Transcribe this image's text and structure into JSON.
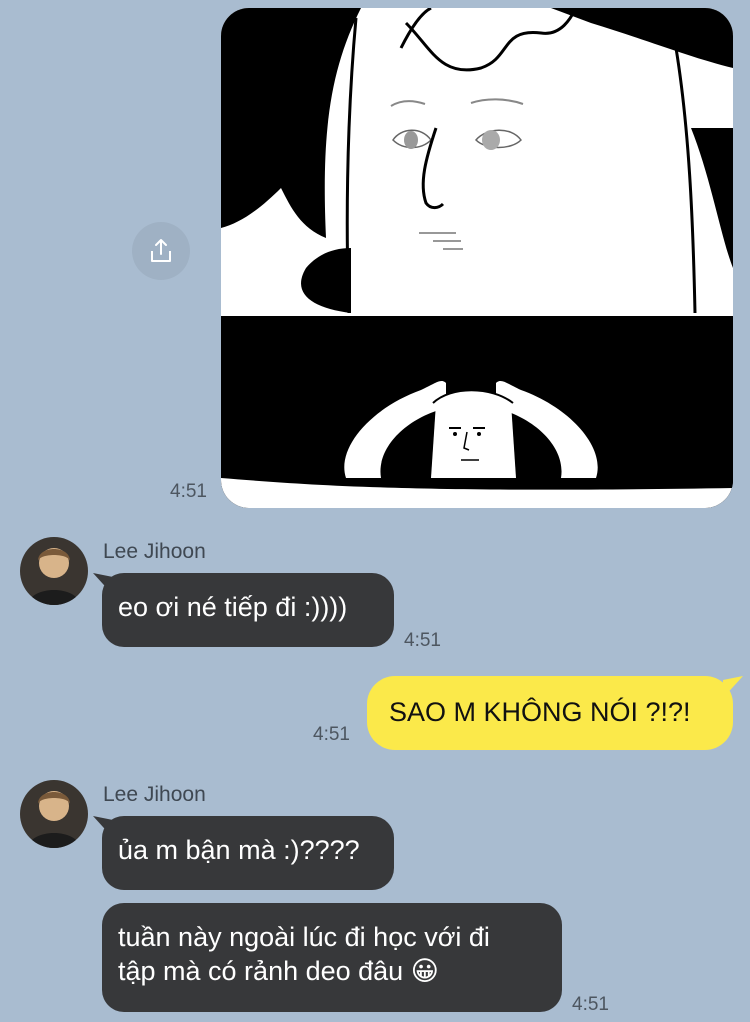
{
  "messages": {
    "image": {
      "time": "4:51",
      "share_icon": "share-icon"
    },
    "msg1": {
      "sender": "Lee Jihoon",
      "text": "eo ơi né tiếp đi :))))",
      "time": "4:51"
    },
    "msg2": {
      "text": "SAO M KHÔNG NÓI ?!?!",
      "time": "4:51"
    },
    "msg3": {
      "sender": "Lee Jihoon",
      "text1": "ủa m bận mà :)????",
      "text2_line1": "tuần này ngoài lúc đi học với đi",
      "text2_line2": "tập mà có rảnh deo đâu",
      "emoji": "😀",
      "time": "4:51"
    }
  },
  "colors": {
    "background": "#a9bcd0",
    "incoming_bubble": "#37383a",
    "outgoing_bubble": "#fbe94a"
  }
}
